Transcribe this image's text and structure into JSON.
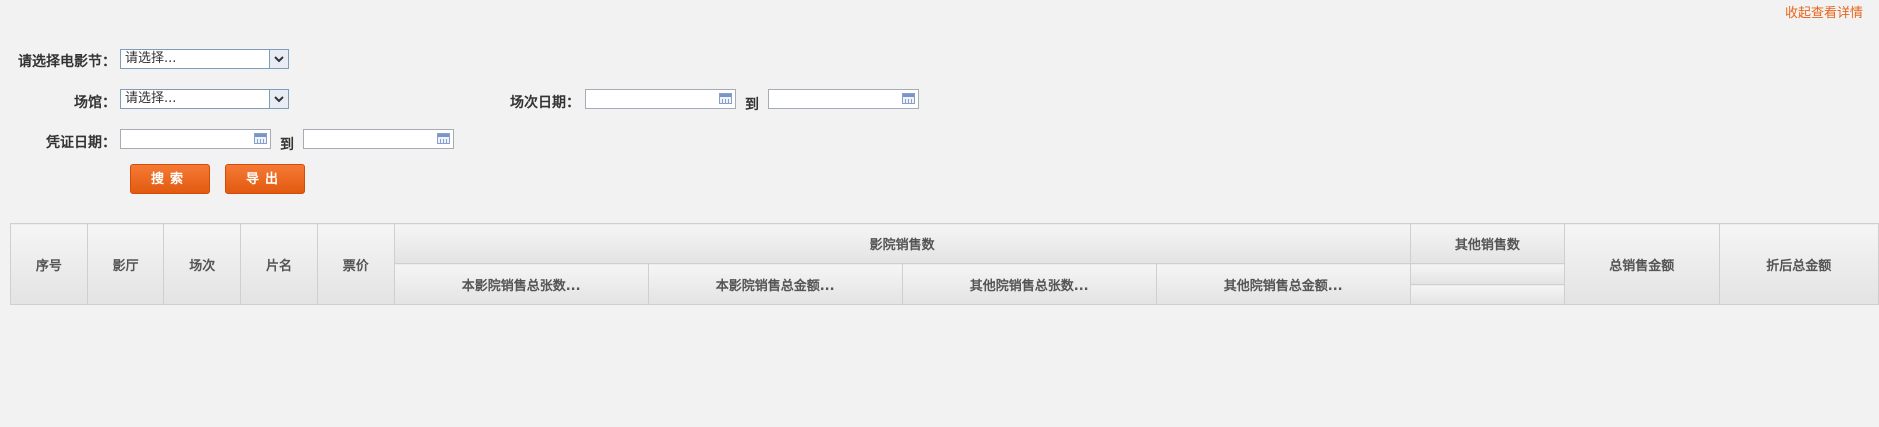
{
  "collapse_link": "收起查看详情",
  "filters": {
    "festival_label": "请选择电影节：",
    "festival_value": "请选择...",
    "venue_label": "场馆：",
    "venue_value": "请选择...",
    "session_date_label": "场次日期：",
    "voucher_date_label": "凭证日期：",
    "to": "到"
  },
  "buttons": {
    "search": "搜索",
    "export": "导出"
  },
  "table": {
    "headers": {
      "seq": "序号",
      "hall": "影厅",
      "session": "场次",
      "film": "片名",
      "price": "票价",
      "cinema_sales": "影院销售数",
      "other_sales": "其他销售数",
      "total_sales_amount": "总销售金额",
      "discounted_total": "折后总金额",
      "sub": [
        "本影院销售总张数...",
        "本影院销售总金额...",
        "其他院销售总张数...",
        "其他院销售总金额..."
      ]
    }
  }
}
